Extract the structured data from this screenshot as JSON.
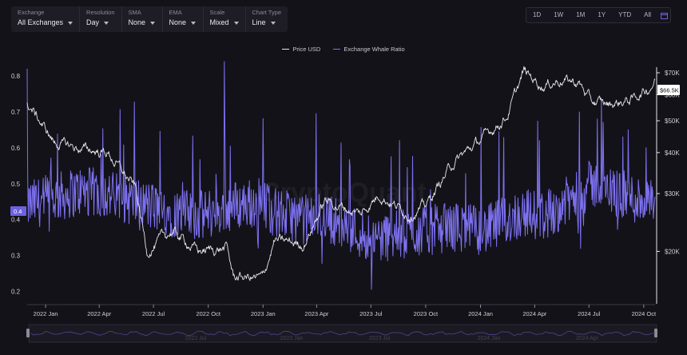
{
  "toolbar": [
    {
      "label": "Exchange",
      "value": "All Exchanges"
    },
    {
      "label": "Resolution",
      "value": "Day"
    },
    {
      "label": "SMA",
      "value": "None"
    },
    {
      "label": "EMA",
      "value": "None"
    },
    {
      "label": "Scale",
      "value": "Mixed"
    },
    {
      "label": "Chart Type",
      "value": "Line"
    }
  ],
  "ranges": [
    "1D",
    "1W",
    "1M",
    "1Y",
    "YTD",
    "All"
  ],
  "watermark": "CryptoQuant",
  "colors": {
    "price": "#e6e6ea",
    "ratio": "#7d71f0",
    "background": "#131219"
  },
  "chart_data": {
    "type": "line",
    "legend_position": "top-center",
    "grid": false,
    "x": [
      "2021-12-01",
      "2022-01-15",
      "2022-03-01",
      "2022-04-15",
      "2022-06-01",
      "2022-06-20",
      "2022-08-01",
      "2022-09-15",
      "2022-11-01",
      "2022-11-12",
      "2022-12-31",
      "2023-01-20",
      "2023-03-10",
      "2023-04-15",
      "2023-06-15",
      "2023-07-15",
      "2023-09-01",
      "2023-10-01",
      "2023-11-15",
      "2024-01-10",
      "2024-02-15",
      "2024-03-14",
      "2024-04-15",
      "2024-05-15",
      "2024-06-15",
      "2024-07-05",
      "2024-08-05",
      "2024-09-10",
      "2024-10-10",
      "2024-10-20"
    ],
    "series": [
      {
        "name": "Price USD",
        "axis": "right",
        "values": [
          57000,
          43000,
          41000,
          40000,
          31000,
          20000,
          23000,
          20000,
          20500,
          16800,
          16500,
          21500,
          21000,
          28500,
          26000,
          30000,
          26000,
          27500,
          37000,
          45000,
          52000,
          70500,
          64000,
          67000,
          65000,
          57000,
          56000,
          58000,
          63000,
          67000
        ]
      },
      {
        "name": "Exchange Whale Ratio",
        "axis": "left",
        "values": [
          0.44,
          0.46,
          0.48,
          0.47,
          0.45,
          0.44,
          0.42,
          0.41,
          0.43,
          0.44,
          0.45,
          0.42,
          0.4,
          0.41,
          0.36,
          0.35,
          0.36,
          0.37,
          0.38,
          0.37,
          0.4,
          0.42,
          0.41,
          0.44,
          0.47,
          0.5,
          0.48,
          0.46,
          0.45,
          0.43
        ]
      }
    ],
    "ratio_spikes": [
      [
        "2021-12-01",
        0.82
      ],
      [
        "2022-10-28",
        0.84
      ],
      [
        "2024-07-15",
        0.68
      ],
      [
        "2024-09-05",
        0.65
      ]
    ],
    "ratio_noise": 0.07,
    "left_axis": {
      "ticks": [
        0.2,
        0.3,
        0.4,
        0.5,
        0.6,
        0.7,
        0.8
      ],
      "min": 0.17,
      "max": 0.82
    },
    "right_axis": {
      "scale": "log",
      "ticks": [
        20000,
        30000,
        40000,
        50000,
        60000,
        70000
      ],
      "tick_labels": [
        "$20K",
        "$30K",
        "$40K",
        "$50K",
        "$60K",
        "$70K"
      ],
      "min": 14000,
      "max": 72000
    },
    "x_ticks": [
      [
        "2022-01-01",
        "2022 Jan"
      ],
      [
        "2022-04-01",
        "2022 Apr"
      ],
      [
        "2022-07-01",
        "2022 Jul"
      ],
      [
        "2022-10-01",
        "2022 Oct"
      ],
      [
        "2023-01-01",
        "2023 Jan"
      ],
      [
        "2023-04-01",
        "2023 Apr"
      ],
      [
        "2023-07-01",
        "2023 Jul"
      ],
      [
        "2023-10-01",
        "2023 Oct"
      ],
      [
        "2024-01-01",
        "2024 Jan"
      ],
      [
        "2024-04-01",
        "2024 Apr"
      ],
      [
        "2024-07-01",
        "2024 Jul"
      ],
      [
        "2024-10-01",
        "2024 Oct"
      ]
    ],
    "x_range": [
      "2021-12-01",
      "2024-10-20"
    ],
    "current_ratio_label": "0.4",
    "current_price_label": "$66.5K",
    "navigator_labels": [
      "2022 Jul",
      "2023 Jan",
      "2023 Jul",
      "2024 Jan",
      "2024 Apr"
    ]
  }
}
